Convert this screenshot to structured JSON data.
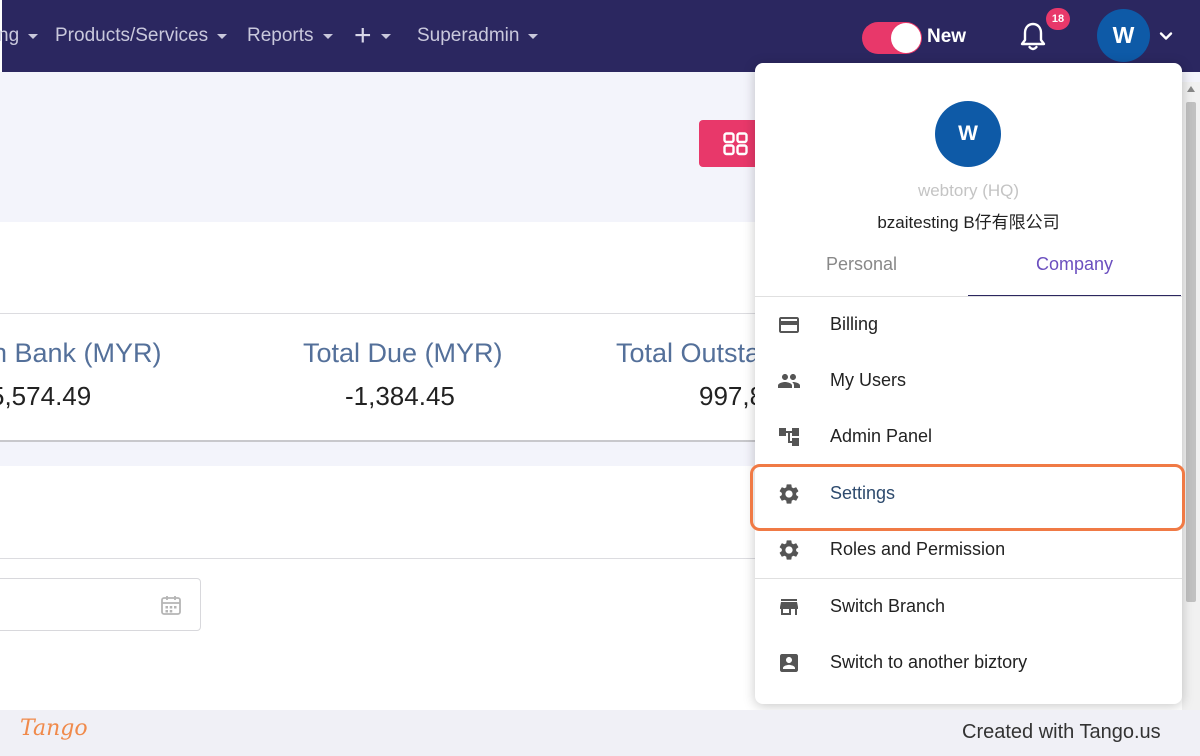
{
  "nav": {
    "items": [
      {
        "label": "ng"
      },
      {
        "label": "Products/Services"
      },
      {
        "label": "Reports"
      },
      {
        "label": "+"
      },
      {
        "label": "Superadmin"
      }
    ],
    "toggle_label": "New",
    "notification_count": "18",
    "avatar_initial": "W"
  },
  "stats": [
    {
      "label": "n Bank (MYR)",
      "value": "5,574.49"
    },
    {
      "label": "Total Due (MYR)",
      "value": "-1,384.45"
    },
    {
      "label": "Total Outsta",
      "value": "997,8"
    }
  ],
  "dropdown": {
    "avatar_initial": "W",
    "org_name": "webtory (HQ)",
    "company_name": "bzaitesting B仔有限公司",
    "tabs": [
      {
        "label": "Personal",
        "active": false
      },
      {
        "label": "Company",
        "active": true
      }
    ],
    "items": [
      {
        "label": "Billing",
        "icon": "credit-card-icon"
      },
      {
        "label": "My Users",
        "icon": "people-icon"
      },
      {
        "label": "Admin Panel",
        "icon": "hierarchy-icon"
      },
      {
        "label": "Settings",
        "icon": "gear-icon"
      },
      {
        "label": "Roles and Permission",
        "icon": "gear-icon"
      },
      {
        "label": "Switch Branch",
        "icon": "store-icon"
      },
      {
        "label": "Switch to another biztory",
        "icon": "contact-card-icon"
      }
    ]
  },
  "footer": {
    "logo": "Tango",
    "credit": "Created with Tango.us"
  },
  "colors": {
    "nav_bg": "#2b2760",
    "accent_pink": "#e8386a",
    "avatar_blue": "#0e5aa7",
    "highlight_orange": "#f07a45",
    "company_tab": "#6b4fbf"
  }
}
